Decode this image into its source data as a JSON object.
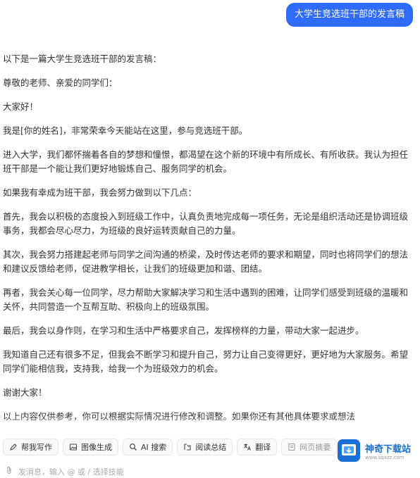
{
  "user_message": "大学生竞选班干部的发言稿",
  "reply": {
    "paragraphs": [
      "以下是一篇大学生竞选班干部的发言稿：",
      "尊敬的老师、亲爱的同学们：",
      "大家好！",
      "我是[你的姓名]，非常荣幸今天能站在这里，参与竞选班干部。",
      "进入大学，我们都怀揣着各自的梦想和憧憬，都渴望在这个新的环境中有所成长、有所收获。我认为担任班干部是一个能让我们更好地锻炼自己、服务同学的机会。",
      "如果我有幸成为班干部，我会努力做到以下几点：",
      "首先，我会以积极的态度投入到班级工作中，认真负责地完成每一项任务，无论是组织活动还是协调班级事务，我都会尽心尽力，为班级的良好运转贡献自己的力量。",
      "其次，我会努力搭建起老师与同学之间沟通的桥梁，及时传达老师的要求和期望，同时也将同学们的想法和建议反馈给老师，促进教学相长，让我们的班级更加和谐、团结。",
      "再者，我会关心每一位同学，尽力帮助大家解决学习和生活中遇到的困难，让同学们感受到班级的温暖和关怀，共同营造一个互帮互助、积极向上的班级氛围。",
      "最后，我会以身作则，在学习和生活中严格要求自己，发挥榜样的力量，带动大家一起进步。",
      "我知道自己还有很多不足，但我会不断学习和提升自己，努力让自己变得更好，更好地为大家服务。希望同学们能相信我，支持我，给我一个为班级效力的机会。",
      "谢谢大家！",
      "以上内容仅供参考，你可以根据实际情况进行修改和调整。如果你还有其他具体要求或想法"
    ]
  },
  "toolbar": {
    "items": [
      {
        "label": "帮我写作",
        "icon": "pen-icon"
      },
      {
        "label": "图像生成",
        "icon": "image-icon"
      },
      {
        "label": "AI 搜索",
        "icon": "search-icon"
      },
      {
        "label": "阅读总结",
        "icon": "read-icon"
      },
      {
        "label": "翻译",
        "icon": "translate-icon"
      },
      {
        "label": "网页摘要",
        "icon": "webpage-icon"
      }
    ]
  },
  "input": {
    "placeholder": "发消息，输入 @ 或 / 选择技能"
  },
  "watermark": {
    "title": "神奇下载站",
    "subtitle": "www.sqxzz.com"
  },
  "colors": {
    "accent": "#2f6bff",
    "watermark_blue": "#1a6fd6"
  }
}
